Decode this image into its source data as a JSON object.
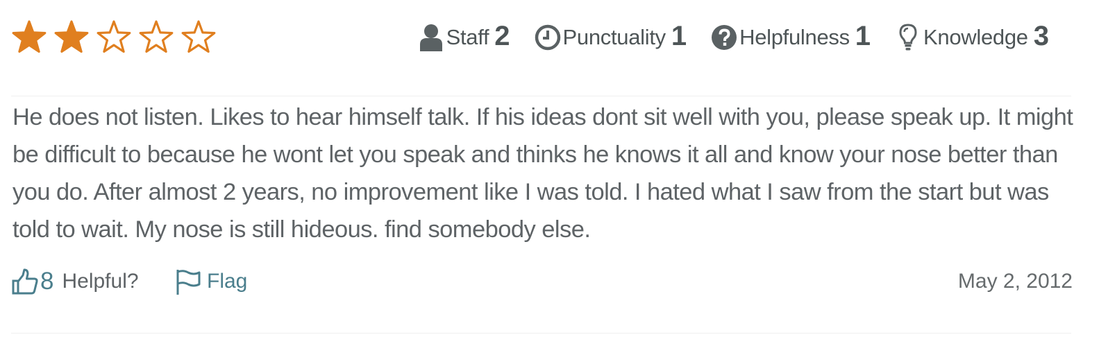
{
  "review": {
    "rating": 2,
    "rating_max": 5,
    "star_color": "#e07f1f",
    "subratings": [
      {
        "label": "Staff",
        "score": "2",
        "icon": "user-icon"
      },
      {
        "label": "Punctuality",
        "score": "1",
        "icon": "clock-icon"
      },
      {
        "label": "Helpfulness",
        "score": "1",
        "icon": "question-circle-icon"
      },
      {
        "label": "Knowledge",
        "score": "3",
        "icon": "lightbulb-icon"
      }
    ],
    "text": "He does not listen. Likes to hear himself talk. If his ideas dont sit well with you, please speak up. It might be difficult to because he wont let you speak and thinks he knows it all and know your nose better than you do. After almost 2 years, no improvement like I was told. I hated what I saw from the start but was told to wait. My nose is still hideous. find somebody else.",
    "helpful_count": "8",
    "helpful_label": "Helpful?",
    "flag_label": "Flag",
    "date": "May 2, 2012",
    "link_color": "#4a7e8c"
  }
}
